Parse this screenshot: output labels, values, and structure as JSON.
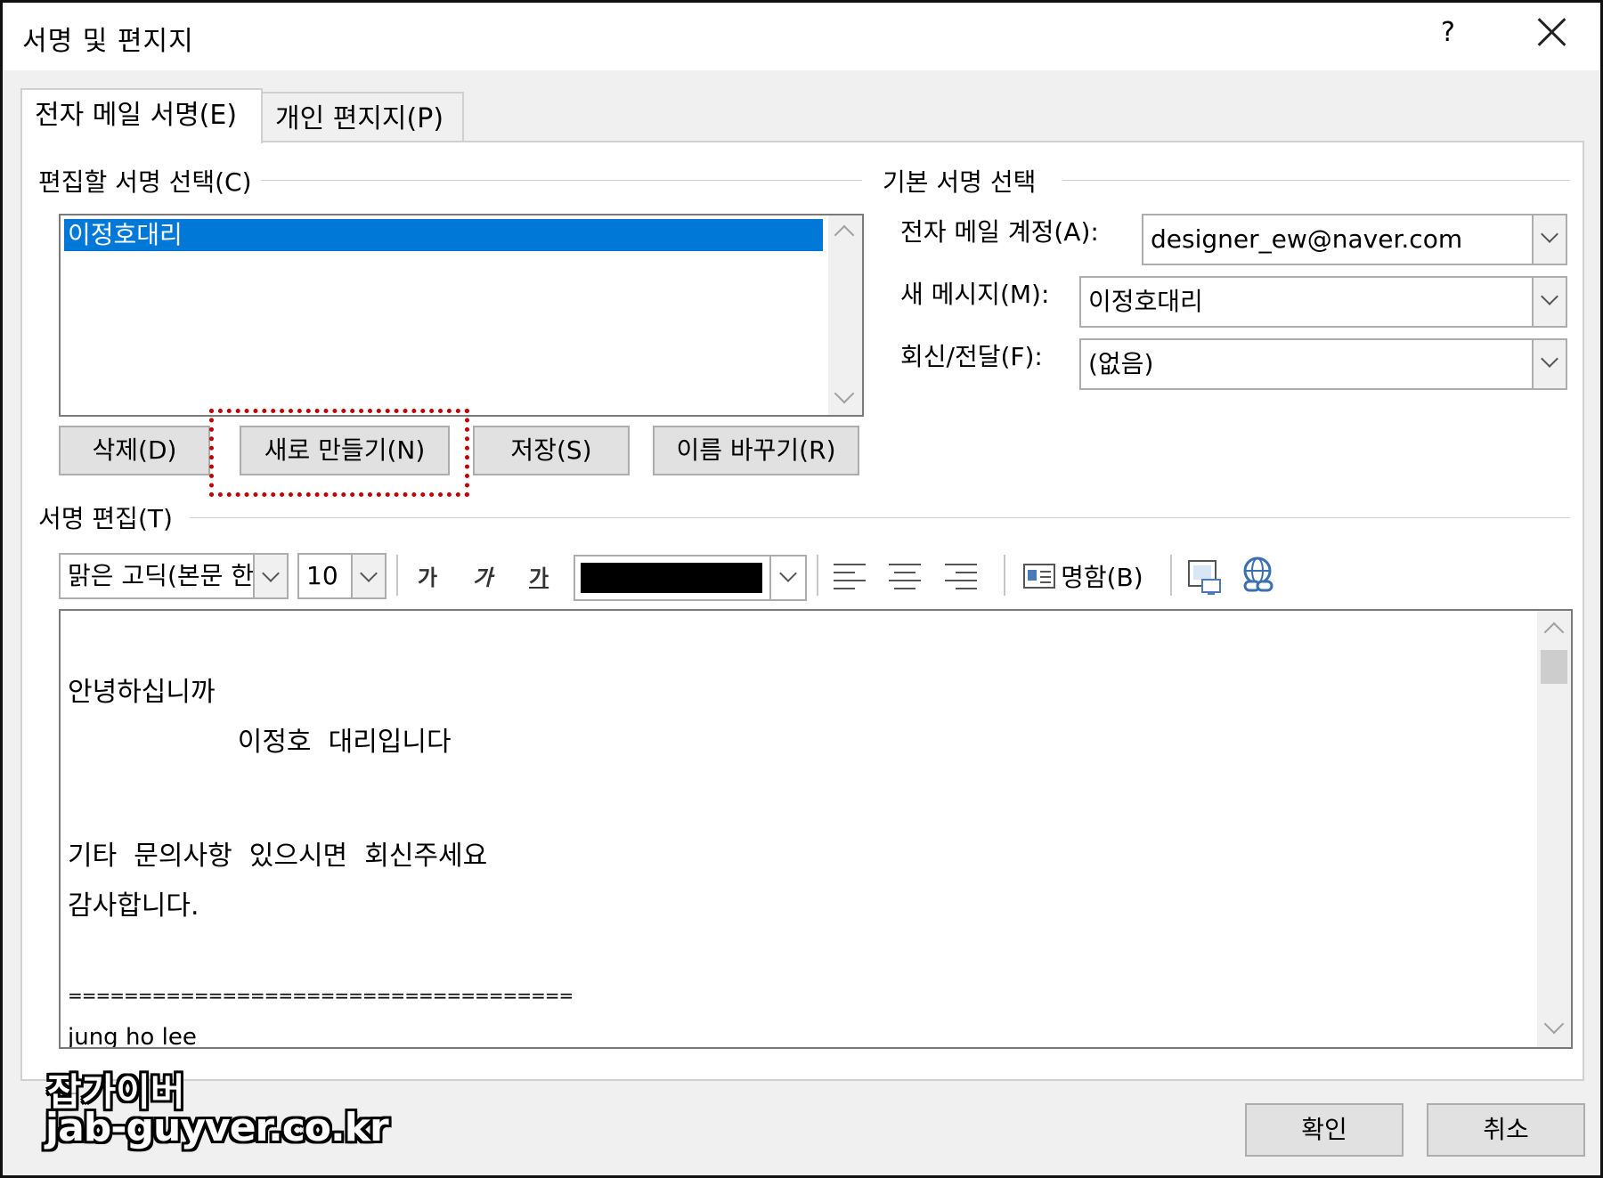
{
  "window": {
    "title": "서명 및 편지지",
    "help": "?",
    "close": "✕"
  },
  "tabs": [
    {
      "label": "전자 메일 서명(E)"
    },
    {
      "label": "개인 편지지(P)"
    }
  ],
  "signature_select": {
    "label": "편집할 서명 선택(C)",
    "items": [
      "이정호대리"
    ],
    "selected": "이정호대리"
  },
  "buttons": {
    "delete": "삭제(D)",
    "new": "새로 만들기(N)",
    "save": "저장(S)",
    "rename": "이름 바꾸기(R)"
  },
  "default_signature": {
    "label": "기본 서명 선택",
    "account_label": "전자 메일 계정(A):",
    "account_value": "designer_ew@naver.com",
    "new_message_label": "새 메시지(M):",
    "new_message_value": "이정호대리",
    "reply_label": "회신/전달(F):",
    "reply_value": "(없음)"
  },
  "edit": {
    "label": "서명 편집(T)",
    "font": "맑은 고딕(본문 한",
    "size": "10",
    "bold": "가",
    "italic": "가",
    "underline": "가",
    "font_color": "#000000",
    "business_card": "명함(B)"
  },
  "editor_lines": [
    "안녕하십니까",
    "                    이정호  대리입니다",
    "기타  문의사항  있으시면  회신주세요",
    "감사합니다.",
    "====================================",
    "jung ho lee"
  ],
  "footer": {
    "ok": "확인",
    "cancel": "취소"
  },
  "watermark": {
    "line1": "잡가이버",
    "line2": "jab-guyver.co.kr"
  }
}
